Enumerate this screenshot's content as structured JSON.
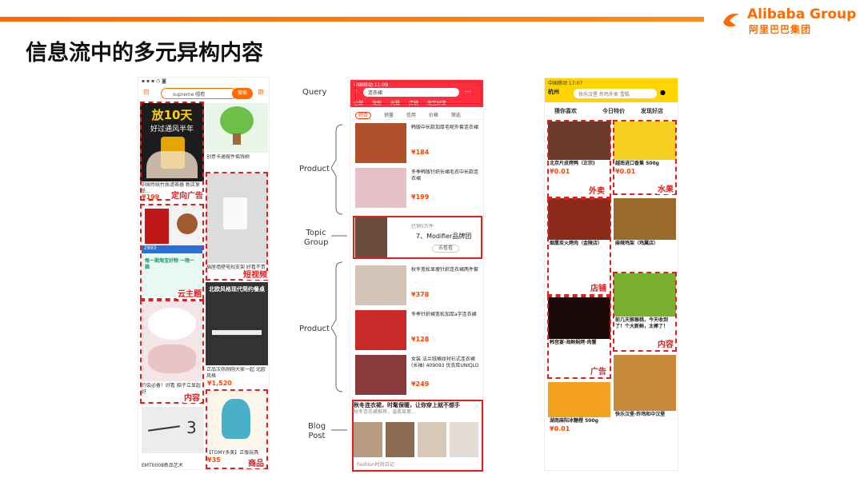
{
  "header": {
    "title": "信息流中的多元异构内容",
    "brand": "Alibaba Group",
    "brand_cn": "阿里巴巴集团"
  },
  "colors": {
    "accent": "#ff6a00",
    "annotation": "#e02020",
    "taobao_red": "#ff2d3d",
    "eleme_yellow": "#ffd400"
  },
  "phone1": {
    "search_placeholder": "supreme 帽檐",
    "search_button": "搜索",
    "promo_line1": "放10天",
    "promo_line2": "好过通风半年",
    "items": [
      {
        "caption": "中国传统竹质滤茶器 新店享受...",
        "price": "¥199",
        "tag": "定向广告"
      },
      {
        "caption": "创意卡通摆件摇钱树",
        "price": "",
        "tag": ""
      },
      {
        "caption": "2893",
        "price": "",
        "tag": ""
      },
      {
        "caption": "插座墙壁电视支架 好看不贵",
        "price": "",
        "tag": "短视频"
      },
      {
        "caption": "每一期淘宝好物 一晚一箱",
        "price": "",
        "tag": "云主题"
      },
      {
        "caption": "北欧风格现代简约餐桌",
        "price": "",
        "tag": ""
      },
      {
        "caption": "约会必备！好看 脑子立显超好",
        "price": "",
        "tag": "内容"
      },
      {
        "caption": "正品次热刚刚大家一起 北欧风格",
        "price": "¥1,520",
        "tag": ""
      },
      {
        "caption": "EMT0008新品艺术",
        "price": "",
        "tag": ""
      },
      {
        "caption": "【TOMY多美】正版玩具",
        "price": "¥35",
        "tag": "商品"
      }
    ]
  },
  "phone2": {
    "status": "中国移动  11:09",
    "search_text": "连衣裙",
    "tabs": [
      "全部",
      "淘抢",
      "天猫",
      "店铺",
      "淘宝好货"
    ],
    "filters": [
      "综合",
      "销量",
      "信用",
      "价格",
      "筛选"
    ],
    "products_top": [
      {
        "title": "韩版中长款加厚毛呢外套连衣裙",
        "price": "¥184"
      },
      {
        "title": "冬季韩版针织长裙毛衣中长款连衣裙",
        "price": "¥199"
      }
    ],
    "topic": {
      "label": "7、Modifier品牌团",
      "sub": "已销5万件",
      "button": "去看看"
    },
    "products_bottom": [
      {
        "title": "秋冬宽松显瘦针织连衣裙两件套",
        "price": "¥378"
      },
      {
        "title": "冬季针织裙宽松加厚a字连衣裙",
        "price": "¥128"
      },
      {
        "title": "女装 法兰绒格纹衬衫式连衣裙(长袖) 409093 优衣库UNIQLO",
        "price": "¥249"
      }
    ],
    "blog": {
      "title": "秋冬连衣裙，时髦保暖，让你穿上就不想手",
      "text": "秋冬连衣裙推荐，温柔显瘦...",
      "author": "Fashion时尚日记"
    }
  },
  "phone3": {
    "status": "中国移动  17:07",
    "city": "杭州",
    "search_placeholder": "快乐汉堡 炸鸡外卖 雪糕",
    "tabs": [
      "猜你喜欢",
      "今日特价",
      "发现好店"
    ],
    "cards": [
      {
        "title": "北京片皮烤鸭（正宗)",
        "price": "¥0.01",
        "tag": "外卖"
      },
      {
        "title": "越南进口香蕉 500g",
        "price": "¥0.01",
        "tag": "水果"
      },
      {
        "title": "烟熏炭火烤肉（金陵店）",
        "price": "",
        "tag": "店铺"
      },
      {
        "title": "麻辣鸡架（鸡翼店）",
        "price": "",
        "tag": ""
      },
      {
        "title": "韩宫宴·海鲜焖烤·肉蟹",
        "price": "",
        "tag": "广告"
      },
      {
        "title": "前几天猕猴桃，今天收到了！个大新鲜，太棒了！",
        "price": "",
        "tag": "内容"
      },
      {
        "title": "湖南麻阳冰糖橙 500g",
        "price": "¥0.01",
        "tag": ""
      },
      {
        "title": "快乐汉堡·炸鸡和中汉堡",
        "price": "",
        "tag": ""
      }
    ]
  },
  "labels": {
    "query": "Query",
    "product": "Product",
    "topic_group": "Topic Group",
    "blog_post": "Blog Post"
  }
}
